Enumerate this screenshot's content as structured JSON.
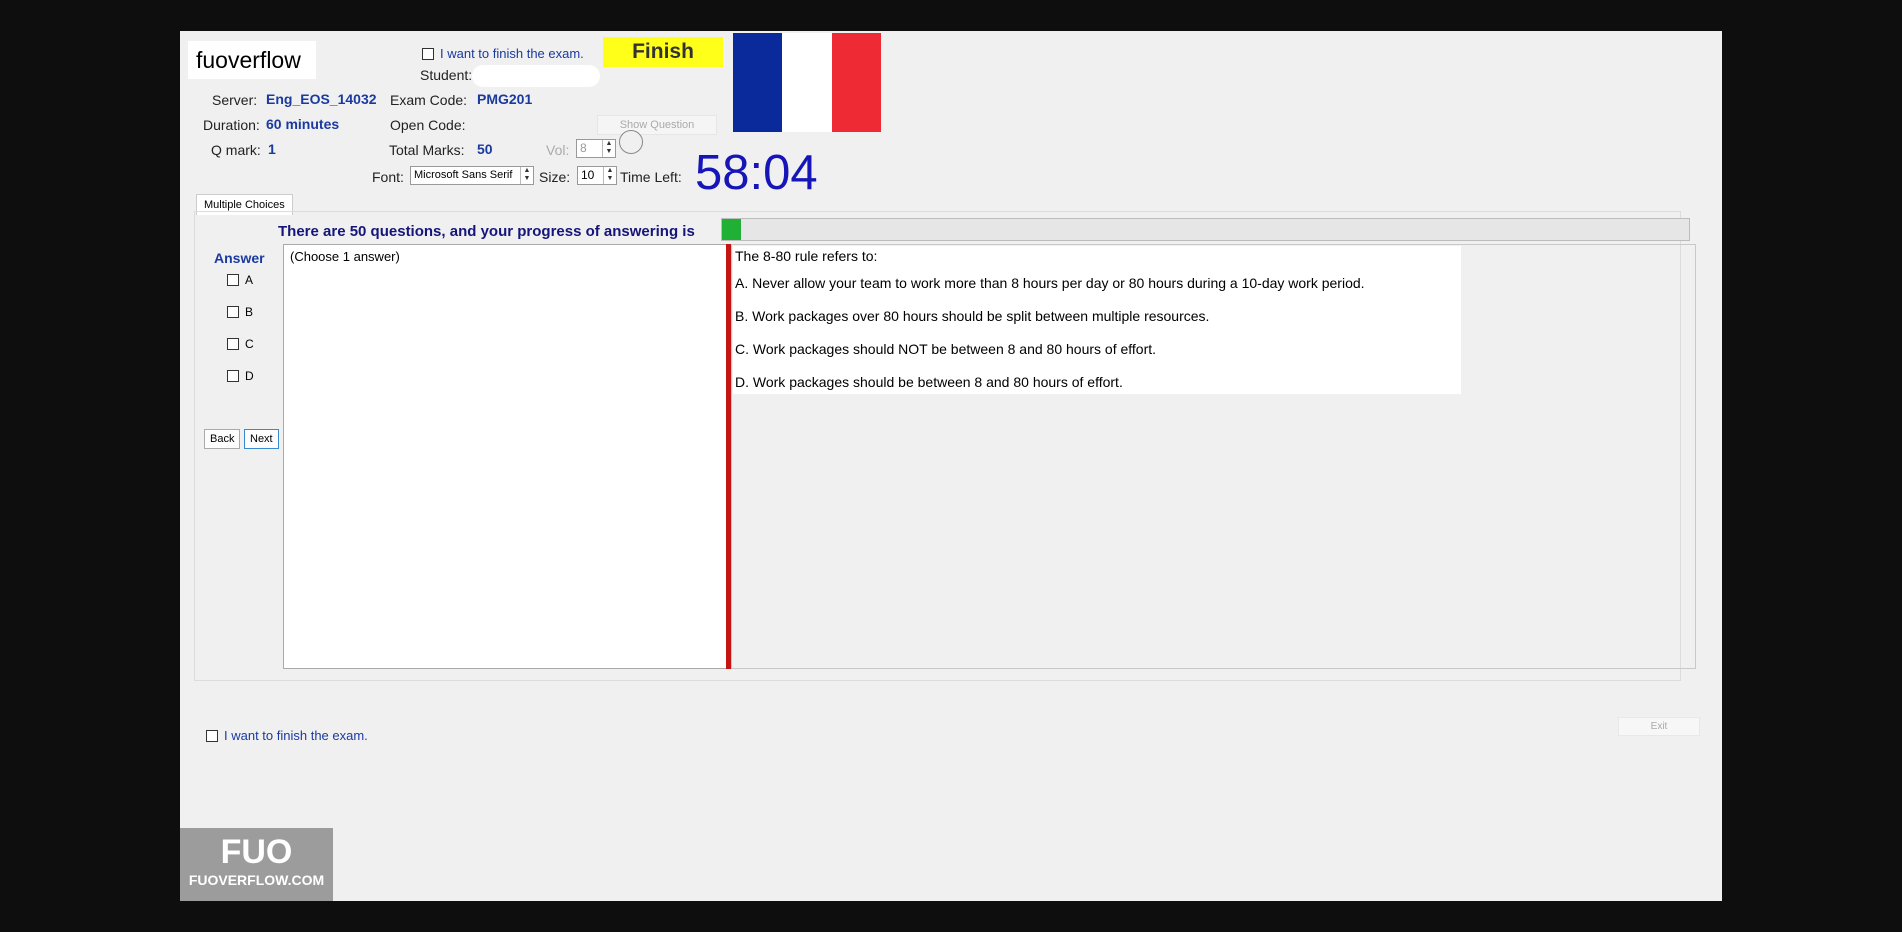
{
  "header": {
    "logo_text": "fuoverflow",
    "top_finish_label": "I want to finish the exam.",
    "finish_button": "Finish",
    "flag_colors": [
      "#0a2a9b",
      "#ffffff",
      "#ee2a35"
    ]
  },
  "info": {
    "server_label": "Server:",
    "server_value": "Eng_EOS_14032",
    "duration_label": "Duration:",
    "duration_value": "60 minutes",
    "qmark_label": "Q mark:",
    "qmark_value": "1",
    "student_label": "Student:",
    "exam_code_label": "Exam Code:",
    "exam_code_value": "PMG201",
    "open_code_label": "Open Code:",
    "show_question_button": "Show Question",
    "total_marks_label": "Total Marks:",
    "total_marks_value": "50",
    "vol_label": "Vol:",
    "vol_value": "8",
    "font_label": "Font:",
    "font_value": "Microsoft Sans Serif",
    "size_label": "Size:",
    "size_value": "10",
    "time_left_label": "Time Left:",
    "time_left_value": "58:04"
  },
  "tabs": [
    {
      "label": "Multiple Choices",
      "active": true
    }
  ],
  "progress": {
    "label": "There are 50 questions, and your progress of answering is",
    "fraction": 0.02,
    "color": "#1fb035"
  },
  "answer": {
    "title": "Answer",
    "options": [
      {
        "label": "A",
        "checked": false
      },
      {
        "label": "B",
        "checked": false
      },
      {
        "label": "C",
        "checked": false
      },
      {
        "label": "D",
        "checked": false
      }
    ],
    "back_button": "Back",
    "next_button": "Next",
    "hint": "(Choose 1 answer)"
  },
  "question": {
    "stem": "The 8-80 rule refers to:",
    "choices": [
      "A.  Never allow your team to work more than 8 hours per day or 80 hours during a 10-day work period.",
      "B.  Work packages over 80 hours should be split between multiple resources.",
      "C.  Work packages should NOT be between 8 and 80 hours of effort.",
      "D.  Work packages should be between 8 and 80 hours of effort."
    ]
  },
  "footer": {
    "finish_label": "I want to finish the exam.",
    "exit_button": "Exit",
    "watermark_big": "FUO",
    "watermark_small": "FUOVERFLOW.COM"
  }
}
